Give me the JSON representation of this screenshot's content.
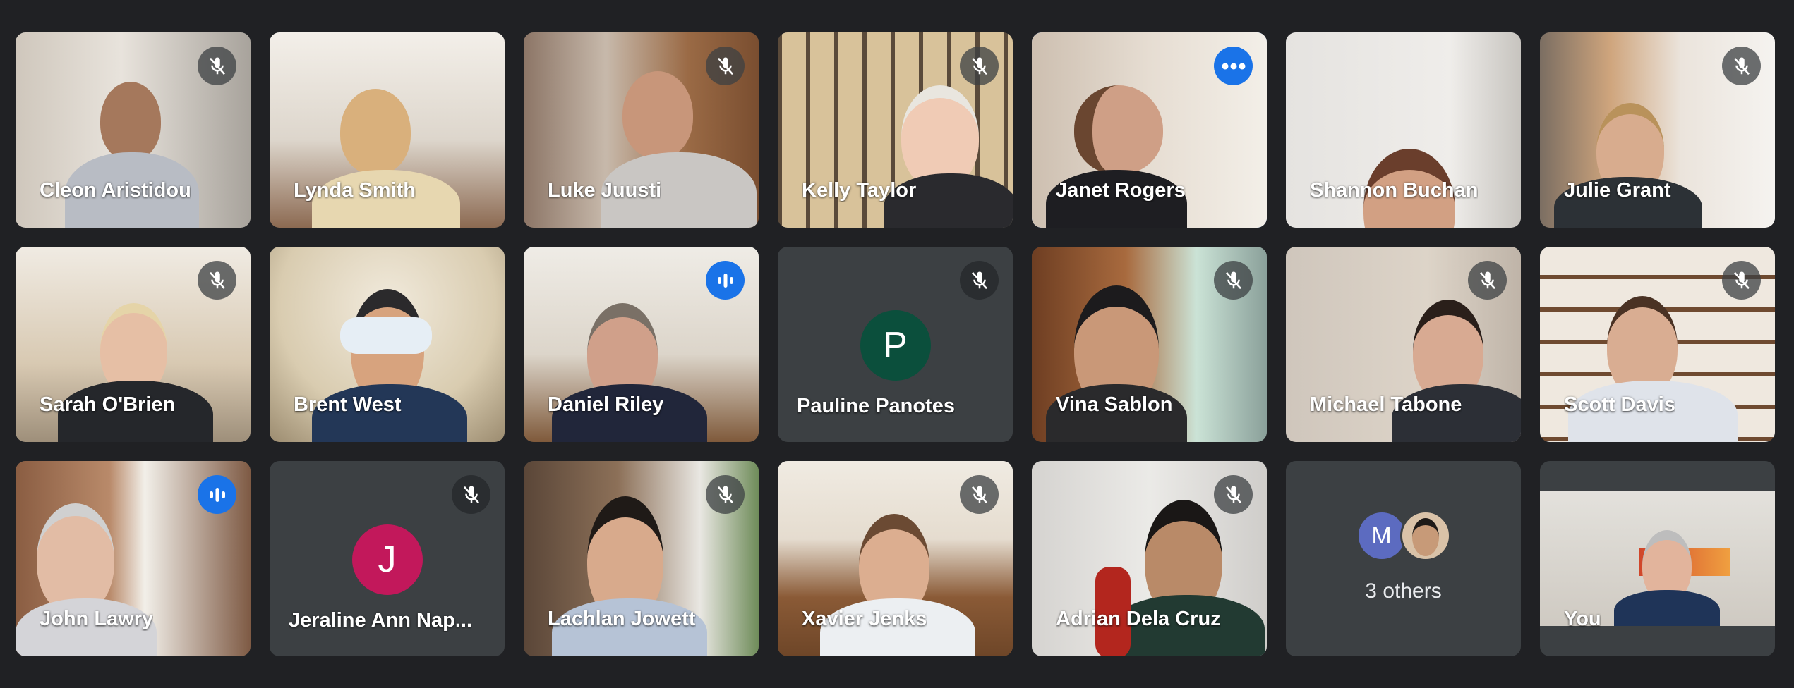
{
  "meeting": {
    "participants": [
      {
        "name": "Cleon Aristidou",
        "mic": "muted"
      },
      {
        "name": "Lynda Smith",
        "mic": "none"
      },
      {
        "name": "Luke Juusti",
        "mic": "muted"
      },
      {
        "name": "Kelly Taylor",
        "mic": "muted"
      },
      {
        "name": "Janet Rogers",
        "mic": "more-options",
        "pinned": true
      },
      {
        "name": "Shannon Buchan",
        "mic": "none"
      },
      {
        "name": "Julie Grant",
        "mic": "muted"
      },
      {
        "name": "Sarah O'Brien",
        "mic": "muted"
      },
      {
        "name": "Brent West",
        "mic": "none"
      },
      {
        "name": "Daniel Riley",
        "mic": "speaking"
      },
      {
        "name": "Pauline Panotes",
        "mic": "muted",
        "avatar_letter": "P"
      },
      {
        "name": "Vina Sablon",
        "mic": "muted"
      },
      {
        "name": "Michael Tabone",
        "mic": "muted"
      },
      {
        "name": "Scott Davis",
        "mic": "muted"
      },
      {
        "name": "John Lawry",
        "mic": "speaking"
      },
      {
        "name": "Jeraline Ann Nap...",
        "mic": "muted",
        "avatar_letter": "J"
      },
      {
        "name": "Lachlan Jowett",
        "mic": "muted"
      },
      {
        "name": "Xavier Jenks",
        "mic": "muted"
      },
      {
        "name": "Adrian Dela Cruz",
        "mic": "muted"
      }
    ],
    "others": {
      "label": "3 others",
      "avatar_letter": "M"
    },
    "self": {
      "name": "You"
    }
  },
  "colors": {
    "background": "#202124",
    "tile": "#3c4043",
    "accent": "#1a73e8",
    "active_border": "#8ab4f8",
    "avatar_pauline": "#0b4f3c",
    "avatar_jeraline": "#c2185b",
    "avatar_others": "#5c6bc0"
  },
  "icons": {
    "muted": "mic-off-icon",
    "speaking": "audio-level-icon",
    "more": "more-horiz-icon"
  }
}
